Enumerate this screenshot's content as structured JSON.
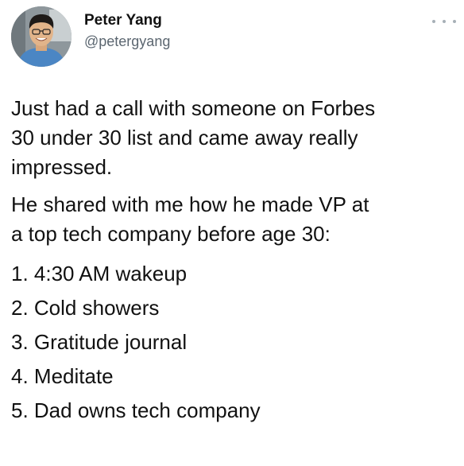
{
  "author": {
    "display_name": "Peter Yang",
    "handle": "@petergyang"
  },
  "menu": {
    "icon": "more-horizontal-icon"
  },
  "tweet": {
    "paragraph_1": "Just had a call with someone on Forbes\n30 under 30 list and came away really\nimpressed.",
    "paragraph_2": "He shared with me how he made VP at\na top tech company before age 30:",
    "list": [
      "1. 4:30 AM wakeup",
      "2. Cold showers",
      "3. Gratitude journal",
      "4. Meditate",
      "5. Dad owns tech company"
    ]
  }
}
